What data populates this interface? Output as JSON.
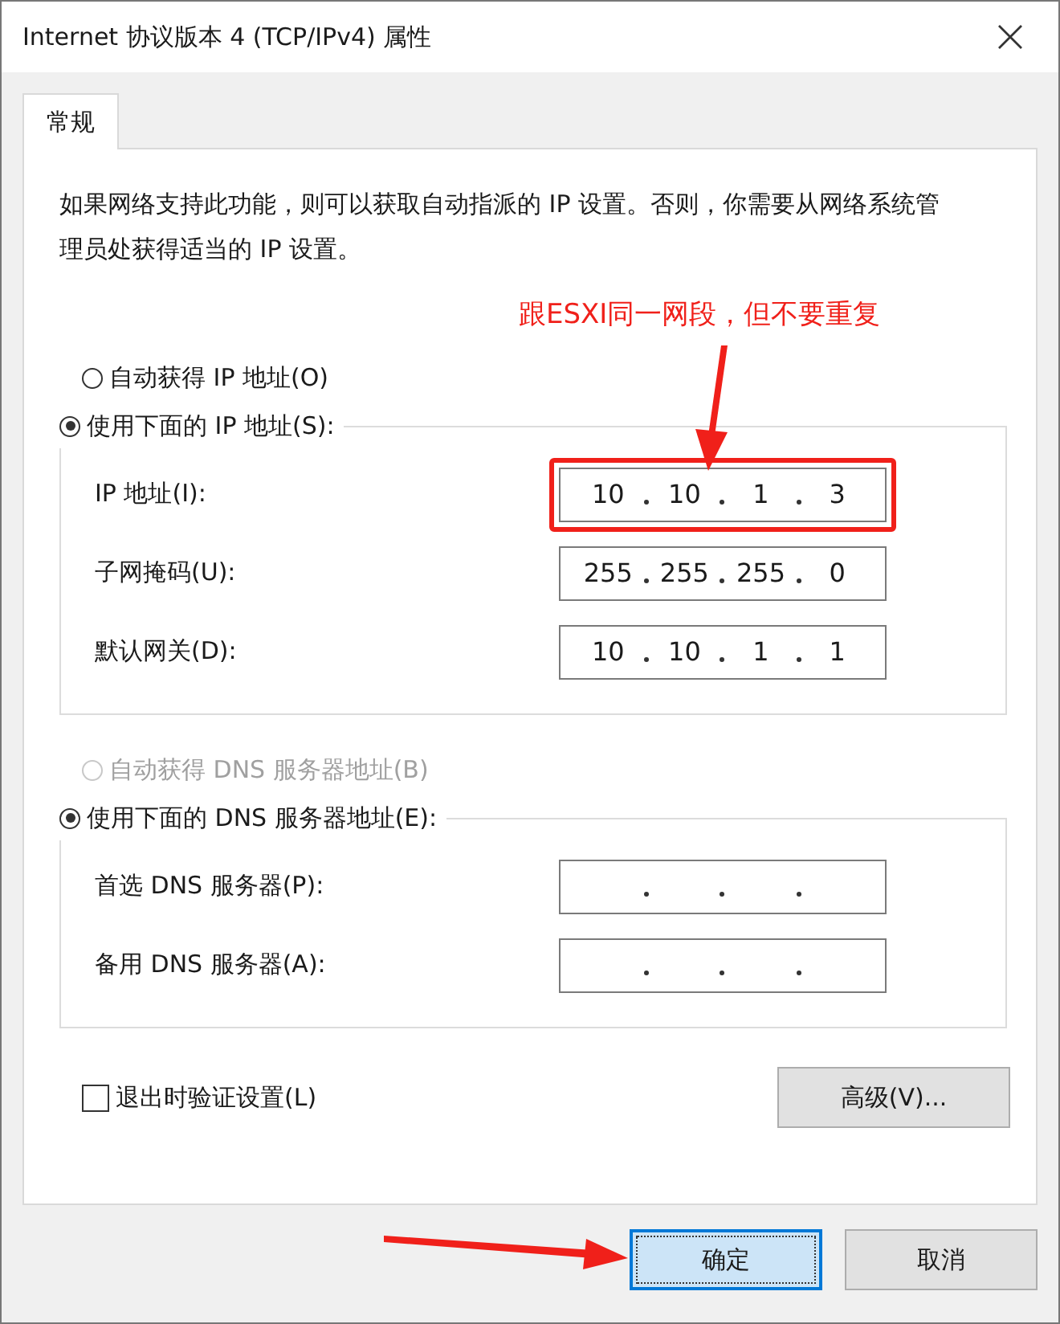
{
  "window": {
    "title": "Internet 协议版本 4 (TCP/IPv4) 属性"
  },
  "tabs": [
    {
      "label": "常规",
      "selected": true
    }
  ],
  "description": "如果网络支持此功能，则可以获取自动指派的 IP 设置。否则，你需要从网络系统管理员处获得适当的 IP 设置。",
  "annotation": {
    "text": "跟ESXI同一网段，但不要重复"
  },
  "ip_section": {
    "auto_option": {
      "label": "自动获得 IP 地址(O)",
      "selected": false,
      "disabled": false
    },
    "manual_option": {
      "label": "使用下面的 IP 地址(S):",
      "selected": true,
      "disabled": false
    },
    "fields": [
      {
        "label": "IP 地址(I):",
        "octets": [
          "10",
          "10",
          "1",
          "3"
        ],
        "highlighted": true
      },
      {
        "label": "子网掩码(U):",
        "octets": [
          "255",
          "255",
          "255",
          "0"
        ],
        "highlighted": false
      },
      {
        "label": "默认网关(D):",
        "octets": [
          "10",
          "10",
          "1",
          "1"
        ],
        "highlighted": false
      }
    ]
  },
  "dns_section": {
    "auto_option": {
      "label": "自动获得 DNS 服务器地址(B)",
      "selected": false,
      "disabled": true
    },
    "manual_option": {
      "label": "使用下面的 DNS 服务器地址(E):",
      "selected": true,
      "disabled": false
    },
    "fields": [
      {
        "label": "首选 DNS 服务器(P):",
        "highlighted": false
      },
      {
        "label": "备用 DNS 服务器(A):",
        "highlighted": false
      }
    ]
  },
  "validate_checkbox": {
    "label": "退出时验证设置(L)",
    "checked": false
  },
  "advanced_button": "高级(V)...",
  "buttons": [
    {
      "label": "确定",
      "default": true
    },
    {
      "label": "取消",
      "default": false
    }
  ]
}
